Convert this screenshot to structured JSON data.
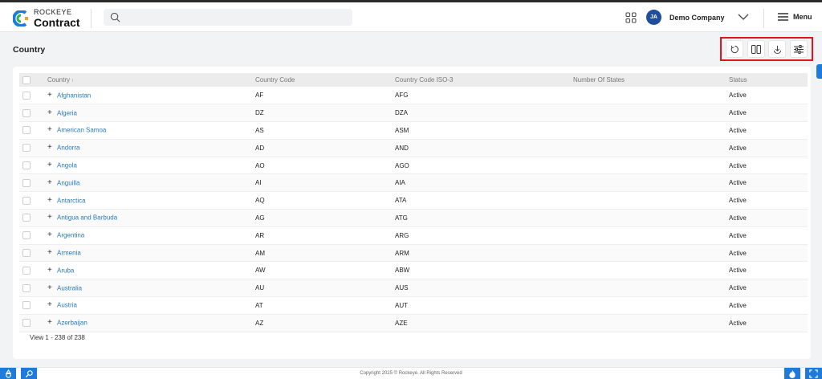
{
  "app": {
    "brand_top": "ROCKEYE",
    "brand_bottom": "Contract"
  },
  "header": {
    "avatar_initials": "JA",
    "company": "Demo Company",
    "menu_label": "Menu"
  },
  "page": {
    "title": "Country"
  },
  "toolbar": {
    "icons": [
      "refresh-icon",
      "columns-icon",
      "download-icon",
      "filter-settings-icon"
    ]
  },
  "table": {
    "columns": [
      "Country",
      "Country Code",
      "Country Code ISO-3",
      "Number Of States",
      "Status"
    ],
    "rows": [
      {
        "name": "Afghanistan",
        "code": "AF",
        "iso3": "AFG",
        "states": "",
        "status": "Active"
      },
      {
        "name": "Algeria",
        "code": "DZ",
        "iso3": "DZA",
        "states": "",
        "status": "Active"
      },
      {
        "name": "American Samoa",
        "code": "AS",
        "iso3": "ASM",
        "states": "",
        "status": "Active"
      },
      {
        "name": "Andorra",
        "code": "AD",
        "iso3": "AND",
        "states": "",
        "status": "Active"
      },
      {
        "name": "Angola",
        "code": "AO",
        "iso3": "AGO",
        "states": "",
        "status": "Active"
      },
      {
        "name": "Anguilla",
        "code": "AI",
        "iso3": "AIA",
        "states": "",
        "status": "Active"
      },
      {
        "name": "Antarctica",
        "code": "AQ",
        "iso3": "ATA",
        "states": "",
        "status": "Active"
      },
      {
        "name": "Antigua and Barbuda",
        "code": "AG",
        "iso3": "ATG",
        "states": "",
        "status": "Active"
      },
      {
        "name": "Argentina",
        "code": "AR",
        "iso3": "ARG",
        "states": "",
        "status": "Active"
      },
      {
        "name": "Armenia",
        "code": "AM",
        "iso3": "ARM",
        "states": "",
        "status": "Active"
      },
      {
        "name": "Aruba",
        "code": "AW",
        "iso3": "ABW",
        "states": "",
        "status": "Active"
      },
      {
        "name": "Australia",
        "code": "AU",
        "iso3": "AUS",
        "states": "",
        "status": "Active"
      },
      {
        "name": "Austria",
        "code": "AT",
        "iso3": "AUT",
        "states": "",
        "status": "Active"
      },
      {
        "name": "Azerbaijan",
        "code": "AZ",
        "iso3": "AZE",
        "states": "",
        "status": "Active"
      }
    ]
  },
  "pager": {
    "text": "View 1 - 238 of 238"
  },
  "footer": {
    "copyright": "Copyright 2025 © Rockeye. All Rights Reserved"
  },
  "colors": {
    "accent": "#1f7ad9",
    "link": "#2a7ab8",
    "highlight_border": "#e3141b",
    "avatar": "#1f4f9c"
  }
}
